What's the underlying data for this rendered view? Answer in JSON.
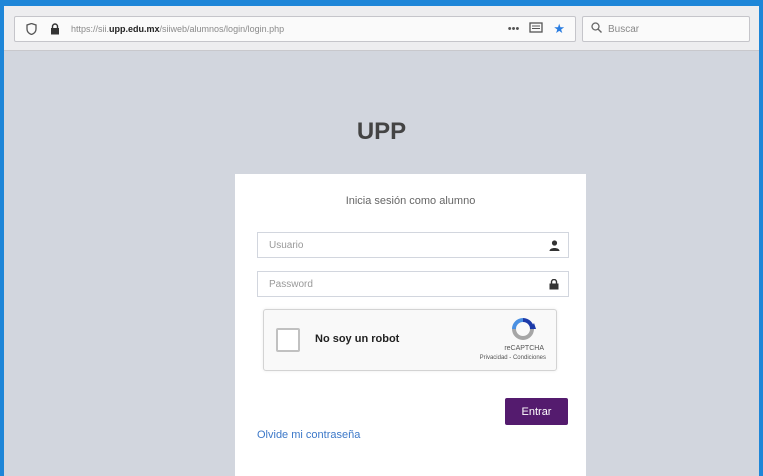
{
  "browser": {
    "url_prefix": "https://sii.",
    "url_domain": "upp.edu.mx",
    "url_path": "/siiweb/alumnos/login/login.php",
    "search_placeholder": "Buscar",
    "more_glyph": "•••"
  },
  "page": {
    "brand": "UPP",
    "card_title": "Inicia sesión como alumno",
    "username_placeholder": "Usuario",
    "password_placeholder": "Password",
    "captcha_label": "No soy un robot",
    "captcha_brand": "reCAPTCHA",
    "captcha_links": "Privacidad - Condiciones",
    "submit_label": "Entrar",
    "forgot_link": "Olvide mi contraseña"
  },
  "icons": {
    "shield": "shield-icon",
    "lock": "lock-icon",
    "reader": "reader-view-icon",
    "star": "bookmark-star-icon",
    "search": "search-icon",
    "user": "user-icon",
    "password": "lock-icon",
    "recaptcha": "recaptcha-logo-icon"
  },
  "colors": {
    "page_background": "#d2d6de",
    "submit_button": "#541b6e",
    "link": "#3c78c8"
  }
}
